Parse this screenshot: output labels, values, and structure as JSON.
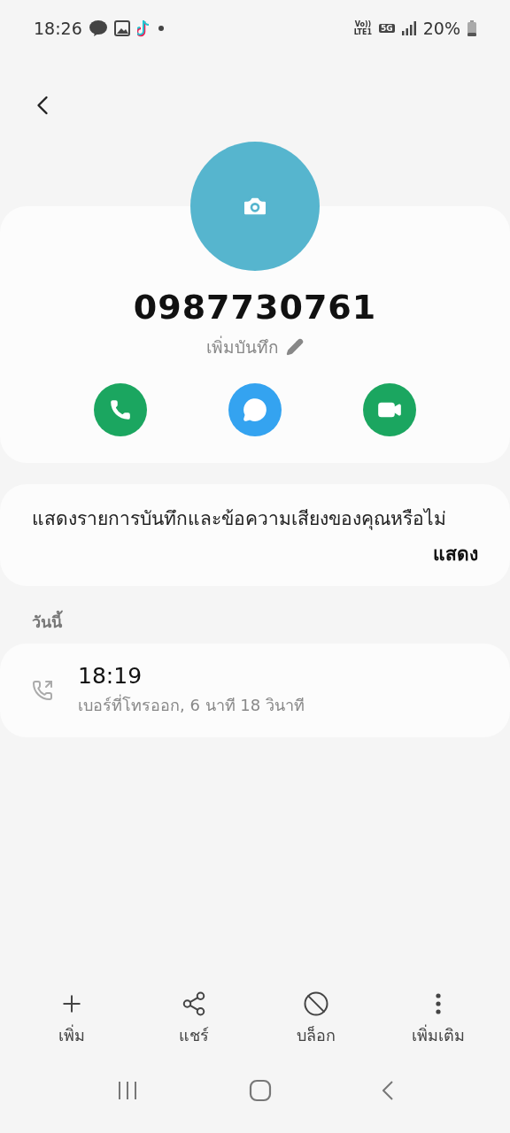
{
  "status_bar": {
    "time": "18:26",
    "network_labels": [
      "Vo))",
      "LTE1",
      "5G"
    ],
    "battery_text": "20%"
  },
  "contact": {
    "number": "0987730761",
    "note_label": "เพิ่มบันทึก"
  },
  "voicemail_prompt": {
    "message": "แสดงรายการบันทึกและข้อความเสียงของคุณหรือไม่",
    "action": "แสดง"
  },
  "history": {
    "section_label": "วันนี้",
    "entries": [
      {
        "kind": "outgoing",
        "time": "18:19",
        "detail": "เบอร์ที่โทรออก, 6 นาที 18 วินาที"
      }
    ]
  },
  "bottom_actions": [
    {
      "kind": "add",
      "label": "เพิ่ม"
    },
    {
      "kind": "share",
      "label": "แชร์"
    },
    {
      "kind": "block",
      "label": "บล็อก"
    },
    {
      "kind": "more",
      "label": "เพิ่มเติม"
    }
  ]
}
